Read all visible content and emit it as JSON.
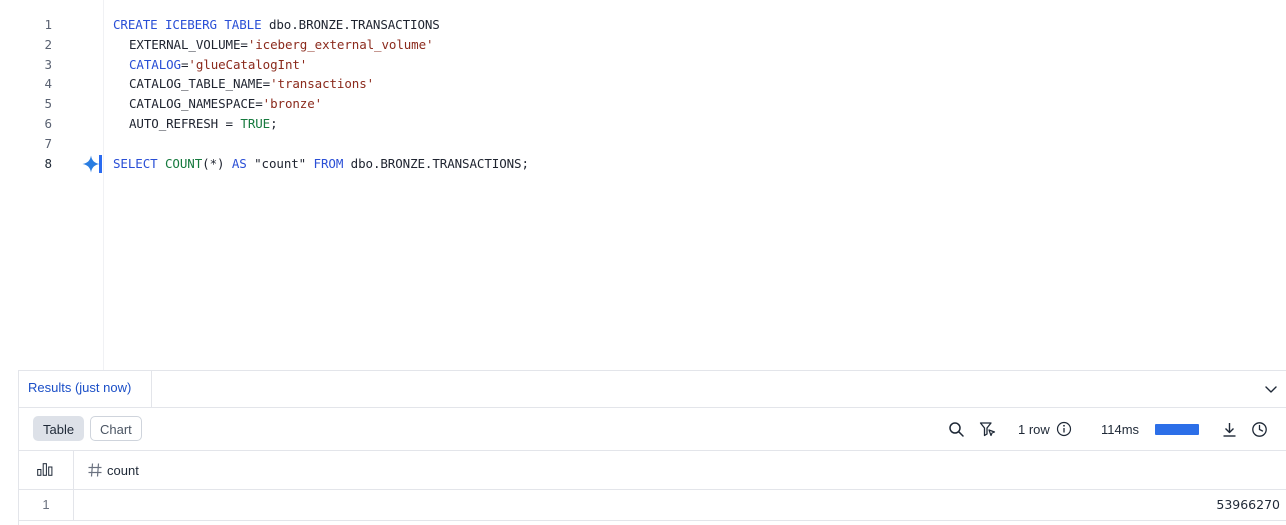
{
  "editor": {
    "lines": [
      {
        "num": "1",
        "t1": "CREATE ICEBERG TABLE",
        "t2": " dbo.BRONZE.TRANSACTIONS"
      },
      {
        "num": "2",
        "t1": "EXTERNAL_VOLUME=",
        "t2": "'iceberg_external_volume'"
      },
      {
        "num": "3",
        "t1": "CATALOG",
        "t2": "=",
        "t3": "'glueCatalogInt'"
      },
      {
        "num": "4",
        "t1": "CATALOG_TABLE_NAME=",
        "t2": "'transactions'"
      },
      {
        "num": "5",
        "t1": "CATALOG_NAMESPACE=",
        "t2": "'bronze'"
      },
      {
        "num": "6",
        "t1": "AUTO_REFRESH = ",
        "t2": "TRUE",
        "t3": ";"
      },
      {
        "num": "7"
      },
      {
        "num": "8",
        "t1": "SELECT",
        "t2": " ",
        "t3": "COUNT",
        "t4": "(*) ",
        "t5": "AS",
        "t6": " \"count\" ",
        "t7": "FROM",
        "t8": " dbo.BRONZE.TRANSACTIONS;"
      }
    ]
  },
  "results": {
    "tab_label": "Results (just now)",
    "view_buttons": {
      "table": "Table",
      "chart": "Chart"
    },
    "row_count": "1 row",
    "timing": "114ms",
    "timing_progress": 1.0,
    "accent_color": "#2c6fe8",
    "columns": [
      {
        "type_icon": "hash-icon",
        "name": "count"
      }
    ],
    "rows": [
      {
        "index": "1",
        "value": "53966270"
      }
    ]
  },
  "icons": {
    "search": "search-icon",
    "filter": "filter-cursor-icon",
    "info": "info-icon",
    "download": "download-icon",
    "history": "clock-icon",
    "collapse": "chevron-down-icon",
    "columns": "column-stats-icon",
    "assist": "sparkle-icon"
  }
}
